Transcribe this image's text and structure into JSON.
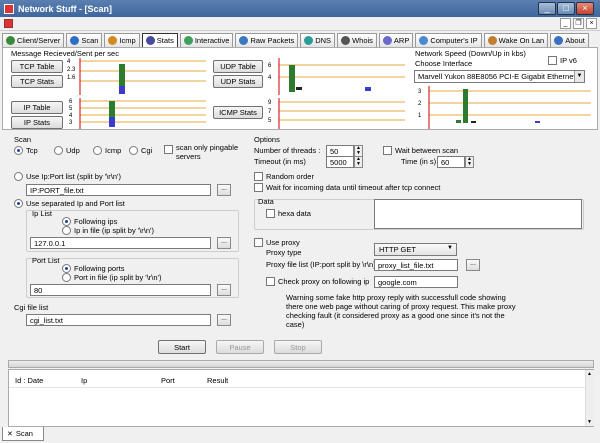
{
  "window": {
    "title": "Network Stuff - [Scan]",
    "min": "_",
    "max": "□",
    "close": "×"
  },
  "tabs": [
    {
      "label": "Client/Server",
      "color": "#3a8a3a"
    },
    {
      "label": "Scan",
      "color": "#2c6fc4"
    },
    {
      "label": "Icmp",
      "color": "#d08a20"
    },
    {
      "label": "Stats",
      "color": "#4a4a9a"
    },
    {
      "label": "Interactive",
      "color": "#3f9f5f"
    },
    {
      "label": "Raw Packets",
      "color": "#3a7ac0"
    },
    {
      "label": "DNS",
      "color": "#2d9a9a"
    },
    {
      "label": "Whois",
      "color": "#555555"
    },
    {
      "label": "ARP",
      "color": "#6a6acc"
    },
    {
      "label": "Computer's IP",
      "color": "#4a8ad0"
    },
    {
      "label": "Wake On Lan",
      "color": "#c08030"
    },
    {
      "label": "About",
      "color": "#3a70c0"
    }
  ],
  "stats": {
    "msg_label": "Message Recieved/Sent per sec",
    "speed_label": "Network Speed (Down/Up in kbs)",
    "interface_label": "Choose Interface",
    "ipv6_label": "IP v6",
    "interface_value": "Marvell Yukon 88E8056 PCI-E Gigabit Ethernet Co",
    "buttons": {
      "tcp_table": "TCP Table",
      "tcp_stats": "TCP Stats",
      "ip_table": "IP Table",
      "ip_stats": "IP Stats",
      "udp_table": "UDP Table",
      "udp_stats": "UDP Stats",
      "icmp_stats": "ICMP Stats"
    },
    "charts": {
      "tcp": {
        "ticks": [
          "4",
          "2.3",
          "1.6"
        ]
      },
      "ip": {
        "ticks": [
          "6",
          "5",
          "4",
          "3"
        ]
      },
      "udp": {
        "ticks": [
          "6",
          "4"
        ]
      },
      "icmp": {
        "ticks": [
          "9",
          "7",
          "5"
        ]
      },
      "speed": {
        "ticks": [
          "3",
          "2",
          "1"
        ]
      }
    }
  },
  "scan": {
    "title": "Scan",
    "protocols": [
      "Tcp",
      "Udp",
      "Icmp",
      "Cgi"
    ],
    "pingable": "scan only pingable servers",
    "use_ipport_list": "Use Ip:Port list (split by '\\r\\n')",
    "ipport_file": "IP:PORT_file.txt",
    "use_separated": "Use separated  Ip and Port list",
    "ip_list": "Ip List",
    "following_ips": "Following ips",
    "ip_in_file": "Ip in file (ip split by '\\r\\n')",
    "ip_value": "127.0.0.1",
    "port_list": "Port List",
    "following_ports": "Following ports",
    "port_in_file": "Port in file (ip split by '\\r\\n')",
    "port_value": "80",
    "cgi_list": "Cgi file list",
    "cgi_file": "cgi_list.txt",
    "browse": "..."
  },
  "options": {
    "title": "Options",
    "threads_label": "Number of threads :",
    "threads_value": "50",
    "timeout_label": "Timeout (in ms)",
    "timeout_value": "5000",
    "wait_between": "Wait between scan",
    "time_label": "Time (in s)",
    "time_value": "60",
    "random_order": "Random order",
    "wait_incoming": "Wait for incoming data until timeout after tcp connect",
    "data_label": "Data",
    "hexa": "hexa data",
    "use_proxy": "Use proxy",
    "proxy_type_label": "Proxy type",
    "proxy_type_value": "HTTP GET",
    "proxy_file_label": "Proxy file list (IP:port split by \\r\\n)",
    "proxy_file_value": "proxy_list_file.txt",
    "check_proxy": "Check proxy on following ip",
    "check_ip": "google.com",
    "warning": "Warning some fake http proxy reply with successfull code showing there one web page without caring of proxy request. This make proxy checking fault (it considered proxy as a good one since it's not the case)"
  },
  "actions": {
    "start": "Start",
    "pause": "Pause",
    "stop": "Stop"
  },
  "results": {
    "columns": [
      "Id : Date",
      "Ip",
      "Port",
      "Result"
    ]
  },
  "bottom_tab": "Scan"
}
